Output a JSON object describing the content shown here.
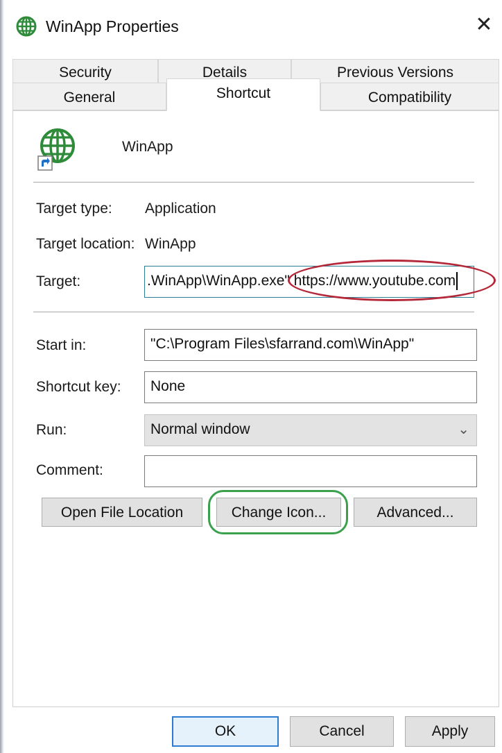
{
  "window": {
    "title": "WinApp Properties",
    "title_icon": "globe-icon",
    "close_glyph": "✕"
  },
  "tabs": {
    "row1": [
      "Security",
      "Details",
      "Previous Versions"
    ],
    "row2": [
      "General",
      "Shortcut",
      "Compatibility"
    ],
    "active": "Shortcut"
  },
  "shortcut": {
    "app_icon": "globe-shortcut-icon",
    "app_name": "WinApp",
    "target_type_label": "Target type:",
    "target_type_value": "Application",
    "target_location_label": "Target location:",
    "target_location_value": "WinApp",
    "target_label": "Target:",
    "target_value": ".WinApp\\WinApp.exe\" https://www.youtube.com",
    "start_in_label": "Start in:",
    "start_in_value": "\"C:\\Program Files\\sfarrand.com\\WinApp\"",
    "shortcut_key_label": "Shortcut key:",
    "shortcut_key_value": "None",
    "run_label": "Run:",
    "run_value": "Normal window",
    "comment_label": "Comment:",
    "comment_value": ""
  },
  "buttons": {
    "open_file_location": "Open File Location",
    "change_icon": "Change Icon...",
    "advanced": "Advanced...",
    "ok": "OK",
    "cancel": "Cancel",
    "apply": "Apply"
  },
  "annotations": {
    "red_ellipse_color": "#b5283a",
    "green_box_color": "#3aa04c"
  }
}
